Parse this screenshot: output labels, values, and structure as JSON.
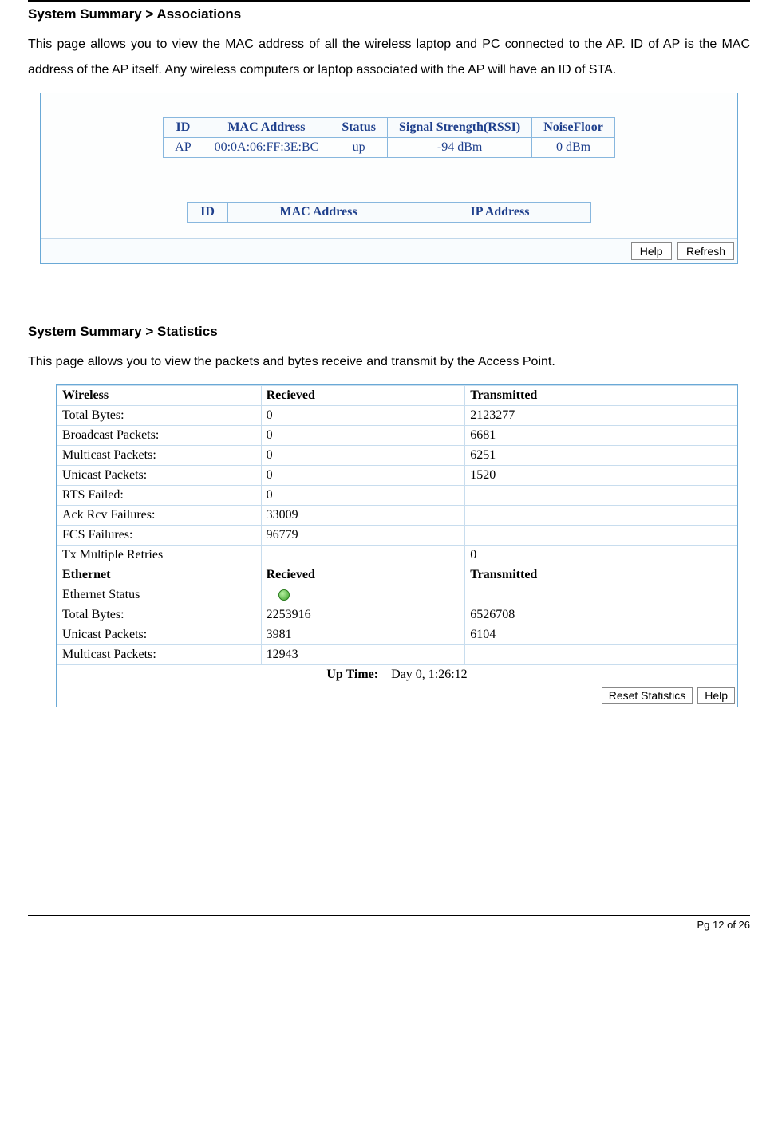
{
  "section1": {
    "breadcrumb": "System Summary > Associations",
    "description": "This page allows you to view the MAC address of all the wireless laptop and PC connected to the AP. ID of AP is the MAC address of the AP itself. Any wireless computers or laptop associated with the AP will have an ID of STA."
  },
  "assoc": {
    "headers": {
      "id": "ID",
      "mac": "MAC Address",
      "status": "Status",
      "rssi": "Signal Strength(RSSI)",
      "noise": "NoiseFloor"
    },
    "row": {
      "id": "AP",
      "mac": "00:0A:06:FF:3E:BC",
      "status": "up",
      "rssi": "-94 dBm",
      "noise": "0  dBm"
    },
    "headers2": {
      "id": "ID",
      "mac": "MAC Address",
      "ip": "IP Address"
    },
    "buttons": {
      "help": "Help",
      "refresh": "Refresh"
    }
  },
  "section2": {
    "breadcrumb": "System Summary > Statistics",
    "description": "This page allows you to view the packets and bytes receive and transmit by the Access Point."
  },
  "stats": {
    "wireless_hdr": {
      "a": "Wireless",
      "b": "Recieved",
      "c": "Transmitted"
    },
    "wireless": [
      {
        "label": "Total Bytes:",
        "rx": "0",
        "tx": "2123277"
      },
      {
        "label": "Broadcast Packets:",
        "rx": "0",
        "tx": "6681"
      },
      {
        "label": "Multicast Packets:",
        "rx": "0",
        "tx": "6251"
      },
      {
        "label": "Unicast Packets:",
        "rx": "0",
        "tx": "1520"
      },
      {
        "label": "RTS Failed:",
        "rx": "0",
        "tx": ""
      },
      {
        "label": "Ack Rcv Failures:",
        "rx": "33009",
        "tx": ""
      },
      {
        "label": "FCS Failures:",
        "rx": "96779",
        "tx": ""
      },
      {
        "label": "Tx Multiple Retries",
        "rx": "",
        "tx": "0"
      }
    ],
    "ethernet_hdr": {
      "a": "Ethernet",
      "b": "Recieved",
      "c": "Transmitted"
    },
    "ethernet_status_label": "Ethernet Status",
    "ethernet": [
      {
        "label": "Total Bytes:",
        "rx": "2253916",
        "tx": "6526708"
      },
      {
        "label": "Unicast Packets:",
        "rx": "3981",
        "tx": "6104"
      },
      {
        "label": "Multicast Packets:",
        "rx": "12943",
        "tx": ""
      }
    ],
    "uptime_label": "Up Time:",
    "uptime_value": "Day 0, 1:26:12",
    "buttons": {
      "reset": "Reset Statistics",
      "help": "Help"
    }
  },
  "footer": "Pg 12 of 26"
}
